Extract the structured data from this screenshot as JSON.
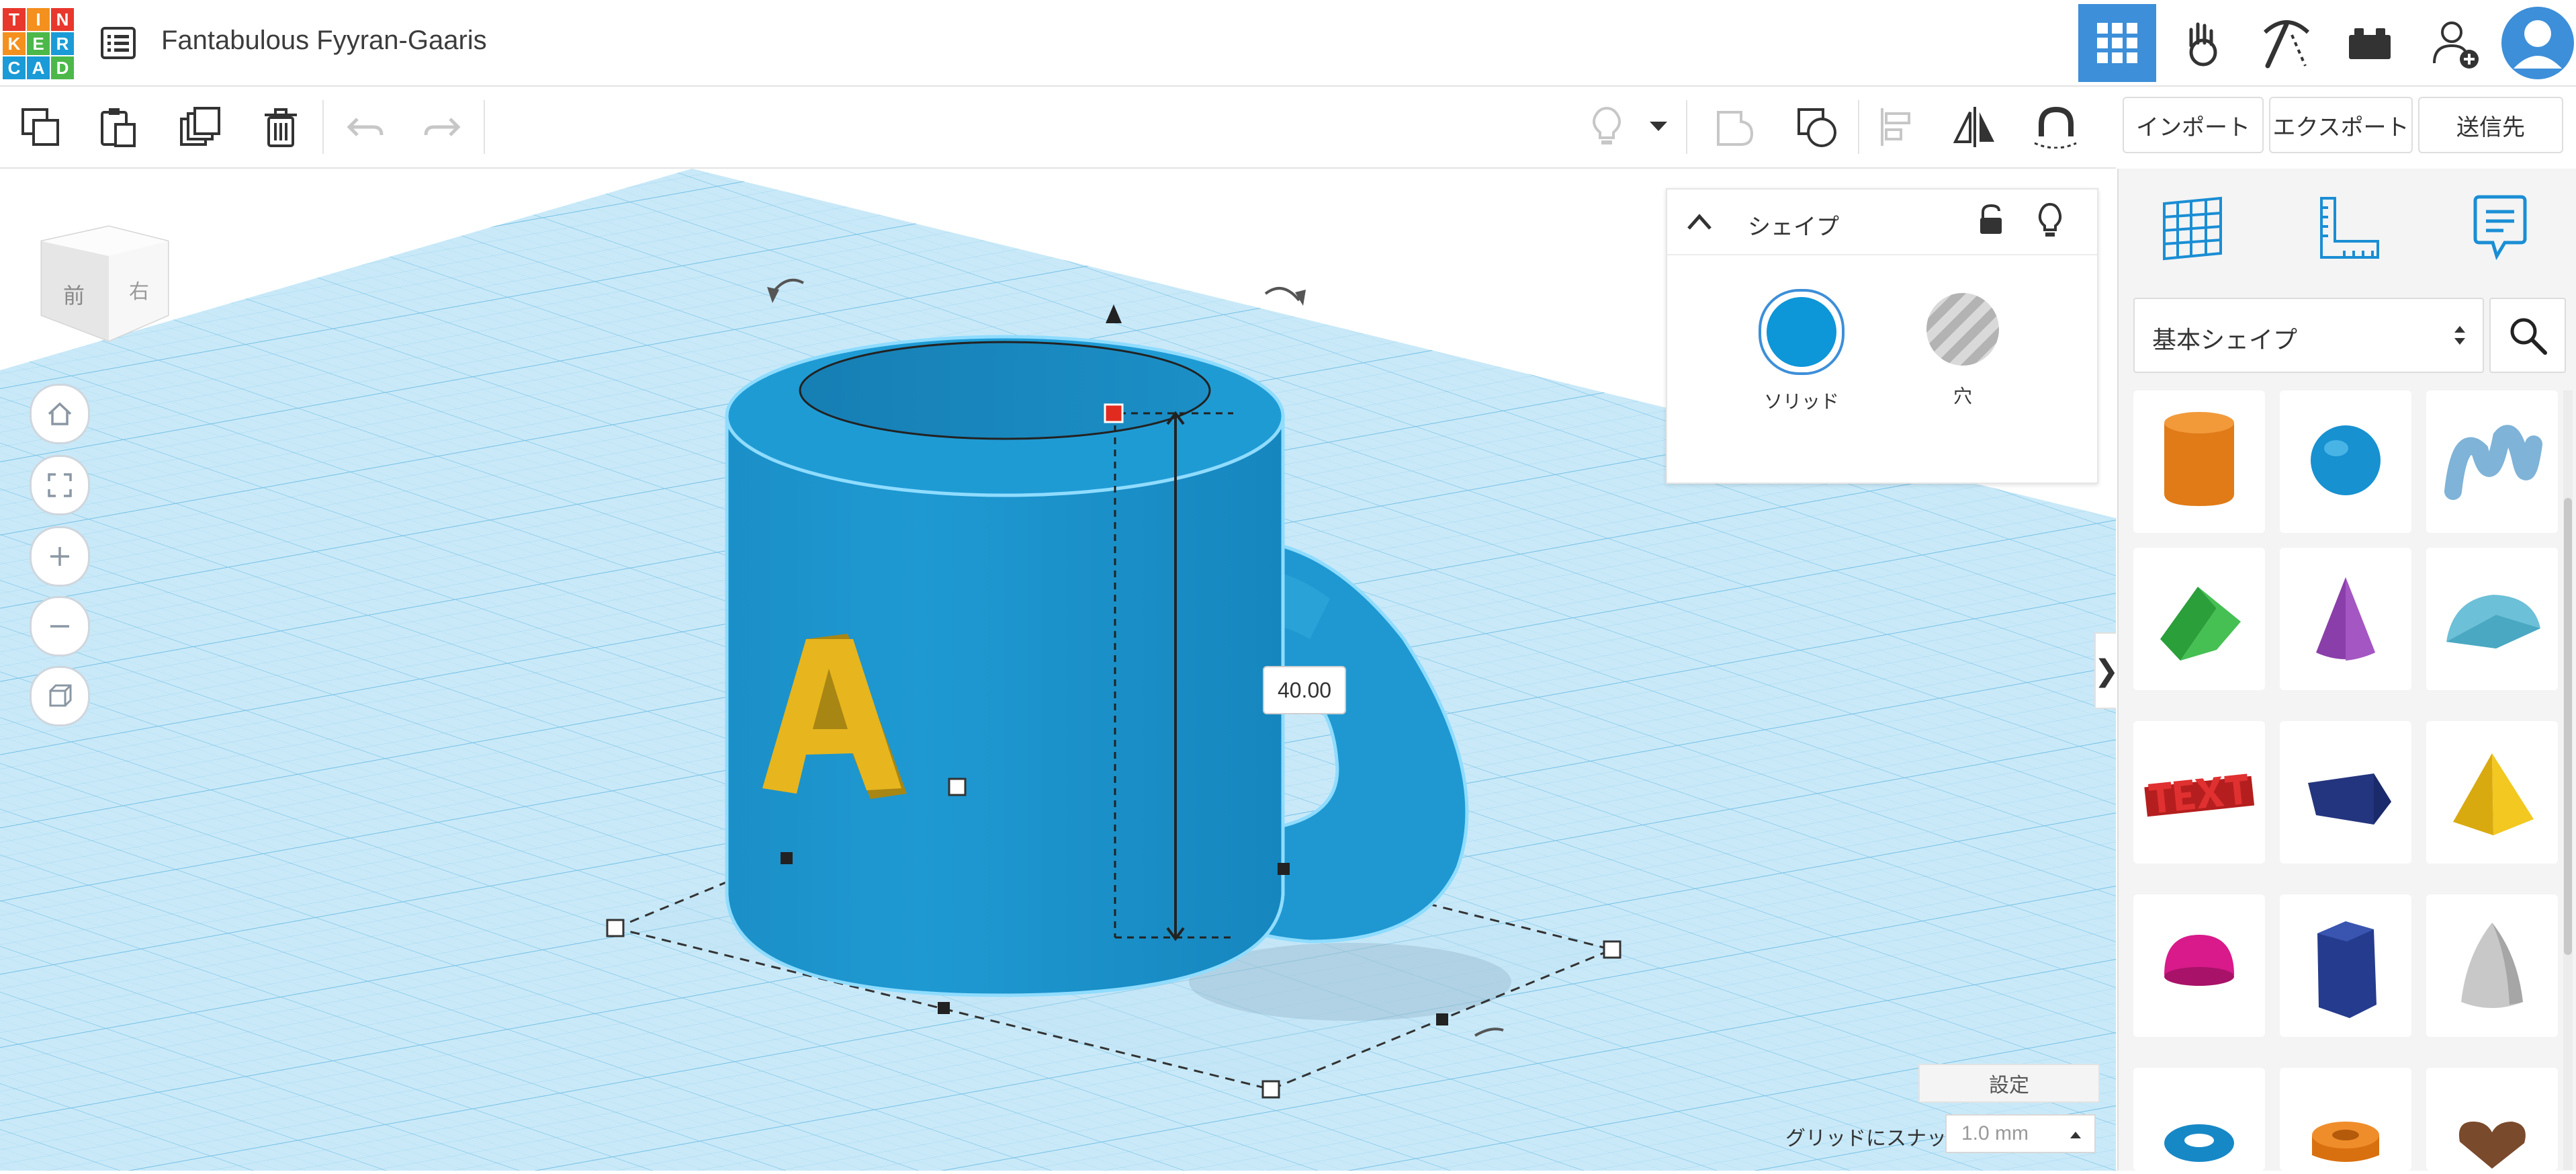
{
  "header": {
    "logo_letters": [
      "T",
      "I",
      "N",
      "K",
      "E",
      "R",
      "C",
      "A",
      "D"
    ],
    "title": "Fantabulous Fyyran-Gaaris",
    "nav_items": [
      "grid-view-icon",
      "hand-icon",
      "pickaxe-icon",
      "bricks-icon",
      "add-user-icon",
      "avatar"
    ]
  },
  "toolbar": {
    "import_label": "インポート",
    "export_label": "エクスポート",
    "send_label": "送信先"
  },
  "inspector": {
    "title": "シェイプ",
    "solid_label": "ソリッド",
    "hole_label": "穴",
    "solid_color": "#0d96d8"
  },
  "library": {
    "category": "基本シェイプ",
    "shapes": [
      "box-orange",
      "sphere",
      "scribble",
      "roof",
      "cone",
      "round-roof",
      "text",
      "wedge",
      "pyramid",
      "half-sphere",
      "polygon",
      "paraboloid",
      "torus",
      "tube",
      "heart"
    ]
  },
  "viewport": {
    "view_cube_front": "前",
    "view_cube_right": "右",
    "dimension_value": "40.00",
    "settings_label": "設定",
    "snap_label": "グリッドにスナップ",
    "snap_value": "1.0 mm",
    "mug_color": "#1e9bd4",
    "letter_color": "#e7b51e"
  }
}
